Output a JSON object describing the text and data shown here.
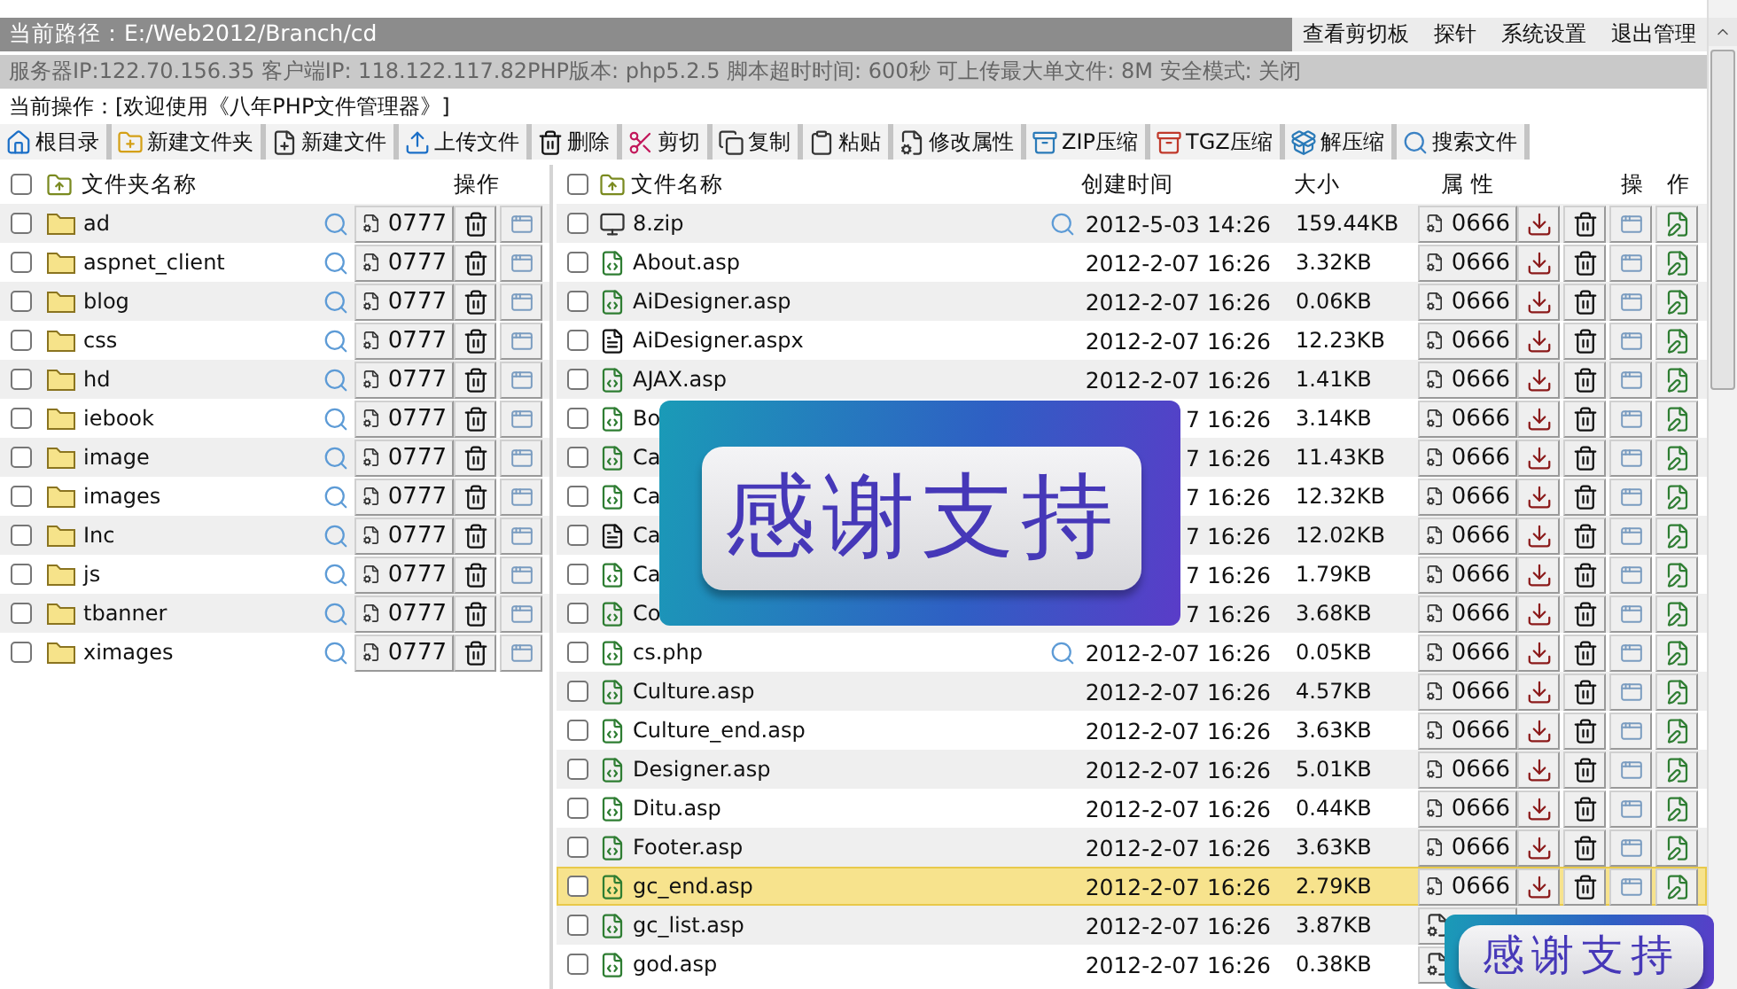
{
  "path_bar": {
    "path": "当前路径：E:/Web2012/Branch/cd",
    "links": [
      "查看剪切板",
      "探针",
      "系统设置",
      "退出管理"
    ]
  },
  "server_info": "服务器IP:122.70.156.35 客户端IP: 118.122.117.82PHP版本: php5.2.5 脚本超时时间: 600秒 可上传最大单文件: 8M 安全模式: 关闭",
  "current_action": "当前操作：[欢迎使用《八年PHP文件管理器》]",
  "toolbar": [
    {
      "label": "根目录",
      "kind": "home"
    },
    {
      "label": "新建文件夹",
      "kind": "new_folder"
    },
    {
      "label": "新建文件",
      "kind": "new_file"
    },
    {
      "label": "上传文件",
      "kind": "upload"
    },
    {
      "label": "删除",
      "kind": "delete"
    },
    {
      "label": "剪切",
      "kind": "cut"
    },
    {
      "label": "复制",
      "kind": "copy"
    },
    {
      "label": "粘贴",
      "kind": "paste"
    },
    {
      "label": "修改属性",
      "kind": "properties"
    },
    {
      "label": "ZIP压缩",
      "kind": "zip"
    },
    {
      "label": "TGZ压缩",
      "kind": "tgz"
    },
    {
      "label": "解压缩",
      "kind": "extract"
    },
    {
      "label": "搜索文件",
      "kind": "search"
    }
  ],
  "folders": {
    "header": {
      "checked": false,
      "name": "文件夹名称",
      "actions": "操作"
    },
    "rows": [
      {
        "name": "ad",
        "mode": "0777",
        "checked": false
      },
      {
        "name": "aspnet_client",
        "mode": "0777",
        "checked": false
      },
      {
        "name": "blog",
        "mode": "0777",
        "checked": false
      },
      {
        "name": "css",
        "mode": "0777",
        "checked": false
      },
      {
        "name": "hd",
        "mode": "0777",
        "checked": false
      },
      {
        "name": "iebook",
        "mode": "0777",
        "checked": false
      },
      {
        "name": "image",
        "mode": "0777",
        "checked": false
      },
      {
        "name": "images",
        "mode": "0777",
        "checked": false
      },
      {
        "name": "Inc",
        "mode": "0777",
        "checked": false
      },
      {
        "name": "js",
        "mode": "0777",
        "checked": false
      },
      {
        "name": "tbanner",
        "mode": "0777",
        "checked": false
      },
      {
        "name": "ximages",
        "mode": "0777",
        "checked": false
      }
    ]
  },
  "files": {
    "header": {
      "checked": false,
      "name": "文件名称",
      "created": "创建时间",
      "size": "大小",
      "attributes": "属 性",
      "actions_1": "操",
      "actions_2": "作"
    },
    "rows": [
      {
        "name": "8.zip",
        "kind": "archive",
        "viewable": true,
        "created": "2012-5-03 14:26",
        "size": "159.44KB",
        "mode": "0666",
        "checked": false,
        "highlighted": false
      },
      {
        "name": "About.asp",
        "kind": "script",
        "viewable": false,
        "created": "2012-2-07 16:26",
        "size": "3.32KB",
        "mode": "0666",
        "checked": false,
        "highlighted": false
      },
      {
        "name": "AiDesigner.asp",
        "kind": "script",
        "viewable": false,
        "created": "2012-2-07 16:26",
        "size": "0.06KB",
        "mode": "0666",
        "checked": false,
        "highlighted": false
      },
      {
        "name": "AiDesigner.aspx",
        "kind": "page",
        "viewable": false,
        "created": "2012-2-07 16:26",
        "size": "12.23KB",
        "mode": "0666",
        "checked": false,
        "highlighted": false
      },
      {
        "name": "AJAX.asp",
        "kind": "script",
        "viewable": false,
        "created": "2012-2-07 16:26",
        "size": "1.41KB",
        "mode": "0666",
        "checked": false,
        "highlighted": false
      },
      {
        "name": "Bo",
        "kind": "script",
        "viewable": false,
        "created": "7 16:26",
        "size": "3.14KB",
        "mode": "0666",
        "checked": false,
        "highlighted": false
      },
      {
        "name": "Ca",
        "kind": "script",
        "viewable": false,
        "created": "7 16:26",
        "size": "11.43KB",
        "mode": "0666",
        "checked": false,
        "highlighted": false
      },
      {
        "name": "Ca",
        "kind": "script",
        "viewable": false,
        "created": "7 16:26",
        "size": "12.32KB",
        "mode": "0666",
        "checked": false,
        "highlighted": false
      },
      {
        "name": "Ca",
        "kind": "page",
        "viewable": false,
        "created": "7 16:26",
        "size": "12.02KB",
        "mode": "0666",
        "checked": false,
        "highlighted": false
      },
      {
        "name": "Ca",
        "kind": "script",
        "viewable": false,
        "created": "7 16:26",
        "size": "1.79KB",
        "mode": "0666",
        "checked": false,
        "highlighted": false
      },
      {
        "name": "Co",
        "kind": "script",
        "viewable": false,
        "created": "7 16:26",
        "size": "3.68KB",
        "mode": "0666",
        "checked": false,
        "highlighted": false
      },
      {
        "name": "cs.php",
        "kind": "script",
        "viewable": true,
        "created": "2012-2-07 16:26",
        "size": "0.05KB",
        "mode": "0666",
        "checked": false,
        "highlighted": false
      },
      {
        "name": "Culture.asp",
        "kind": "script",
        "viewable": false,
        "created": "2012-2-07 16:26",
        "size": "4.57KB",
        "mode": "0666",
        "checked": false,
        "highlighted": false
      },
      {
        "name": "Culture_end.asp",
        "kind": "script",
        "viewable": false,
        "created": "2012-2-07 16:26",
        "size": "3.63KB",
        "mode": "0666",
        "checked": false,
        "highlighted": false
      },
      {
        "name": "Designer.asp",
        "kind": "script",
        "viewable": false,
        "created": "2012-2-07 16:26",
        "size": "5.01KB",
        "mode": "0666",
        "checked": false,
        "highlighted": false
      },
      {
        "name": "Ditu.asp",
        "kind": "script",
        "viewable": false,
        "created": "2012-2-07 16:26",
        "size": "0.44KB",
        "mode": "0666",
        "checked": false,
        "highlighted": false
      },
      {
        "name": "Footer.asp",
        "kind": "script",
        "viewable": false,
        "created": "2012-2-07 16:26",
        "size": "3.63KB",
        "mode": "0666",
        "checked": false,
        "highlighted": false
      },
      {
        "name": "gc_end.asp",
        "kind": "script",
        "viewable": false,
        "created": "2012-2-07 16:26",
        "size": "2.79KB",
        "mode": "0666",
        "checked": false,
        "highlighted": true
      },
      {
        "name": "gc_list.asp",
        "kind": "script",
        "viewable": false,
        "created": "2012-2-07 16:26",
        "size": "3.87KB",
        "checked": false,
        "highlighted": false
      },
      {
        "name": "god.asp",
        "kind": "script",
        "viewable": false,
        "created": "2012-2-07 16:26",
        "size": "0.38KB",
        "checked": false,
        "highlighted": false
      }
    ]
  },
  "overlays": [
    {
      "text": "感谢支持"
    },
    {
      "text": "感谢支持"
    }
  ]
}
